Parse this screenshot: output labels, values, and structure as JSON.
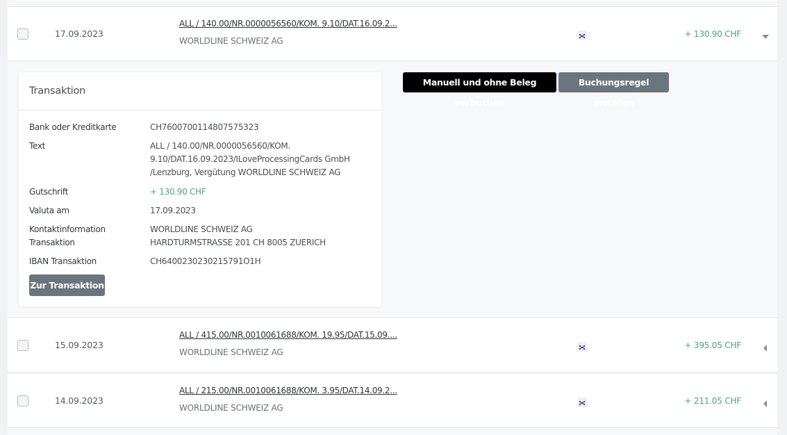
{
  "transactions": [
    {
      "date": "17.09.2023",
      "description": "ALL / 140.00/NR.0000056560/KOM. 9.10/DAT.16.09.2...",
      "payee": "WORLDLINE SCHWEIZ AG",
      "amount": "+ 130.90 CHF",
      "expanded": true
    },
    {
      "date": "15.09.2023",
      "description": "ALL / 415.00/NR.0010061688/KOM. 19.95/DAT.15.09....",
      "payee": "WORLDLINE SCHWEIZ AG",
      "amount": "+ 395.05 CHF",
      "expanded": false
    },
    {
      "date": "14.09.2023",
      "description": "ALL / 215.00/NR.0010061688/KOM. 3.95/DAT.14.09.2...",
      "payee": "WORLDLINE SCHWEIZ AG",
      "amount": "+ 211.05 CHF",
      "expanded": false
    }
  ],
  "detail": {
    "title": "Transaktion",
    "bank_label": "Bank oder Kreditkarte",
    "bank_value": "CH7600700114807575323",
    "text_label": "Text",
    "text_line1": "ALL / 140.00/NR.0000056560/KOM.",
    "text_line2": "9.10/DAT.16.09.2023/ILoveProcessingCards GmbH",
    "text_line3": "/Lenzburg, Vergütung WORLDLINE SCHWEIZ AG",
    "credit_label": "Gutschrift",
    "credit_value": "+ 130.90 CHF",
    "valuta_label": "Valuta am",
    "valuta_value": "17.09.2023",
    "contact_label_line1": "Kontaktinformation",
    "contact_label_line2": "Transaktion",
    "contact_value_line1": "WORLDLINE SCHWEIZ AG",
    "contact_value_line2": "HARDTURMSTRASSE 201 CH 8005 ZUERICH",
    "iban_label": "IBAN Transaktion",
    "iban_value": "CH6400230230215791O1H",
    "goto_button": "Zur Transaktion"
  },
  "actions": {
    "manual_book": "Manuell und ohne Beleg verbuchen",
    "create_rule": "Buchungsregel erstellen"
  },
  "colors": {
    "credit_green": "#4aa57a",
    "button_gray": "#6c757d",
    "button_black": "#000000"
  }
}
